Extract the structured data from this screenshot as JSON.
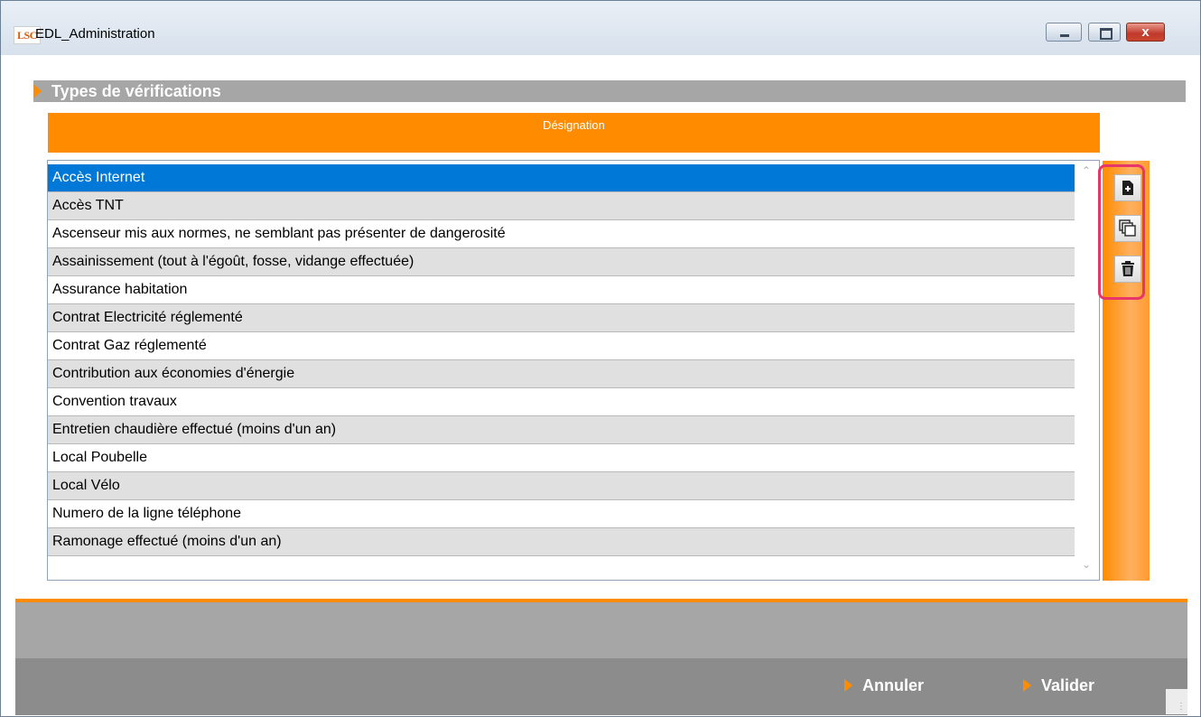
{
  "window": {
    "logo": "LSC",
    "title": "EDL_Administration",
    "close_glyph": "x"
  },
  "section": {
    "title": "Types de vérifications"
  },
  "table": {
    "column_header": "Désignation",
    "selected_index": 0,
    "rows": [
      "Accès Internet",
      "Accès TNT",
      "Ascenseur mis aux normes, ne semblant pas présenter de dangerosité",
      "Assainissement (tout à l'égoût, fosse, vidange effectuée)",
      "Assurance habitation",
      "Contrat Electricité réglementé",
      "Contrat Gaz réglementé",
      "Contribution aux économies d'énergie",
      "Convention travaux",
      "Entretien chaudière effectué (moins d'un an)",
      "Local Poubelle",
      "Local Vélo",
      "Numero de la ligne téléphone",
      "Ramonage effectué (moins d'un an)"
    ]
  },
  "actions": {
    "add_icon": "add-document-icon",
    "duplicate_icon": "duplicate-icon",
    "delete_icon": "trash-icon"
  },
  "footer": {
    "cancel_label": "Annuler",
    "validate_label": "Valider"
  },
  "colors": {
    "accent": "#ff8c00",
    "selection": "#0078d7",
    "highlight_box": "#e8356a",
    "header_gray": "#a6a6a6"
  }
}
